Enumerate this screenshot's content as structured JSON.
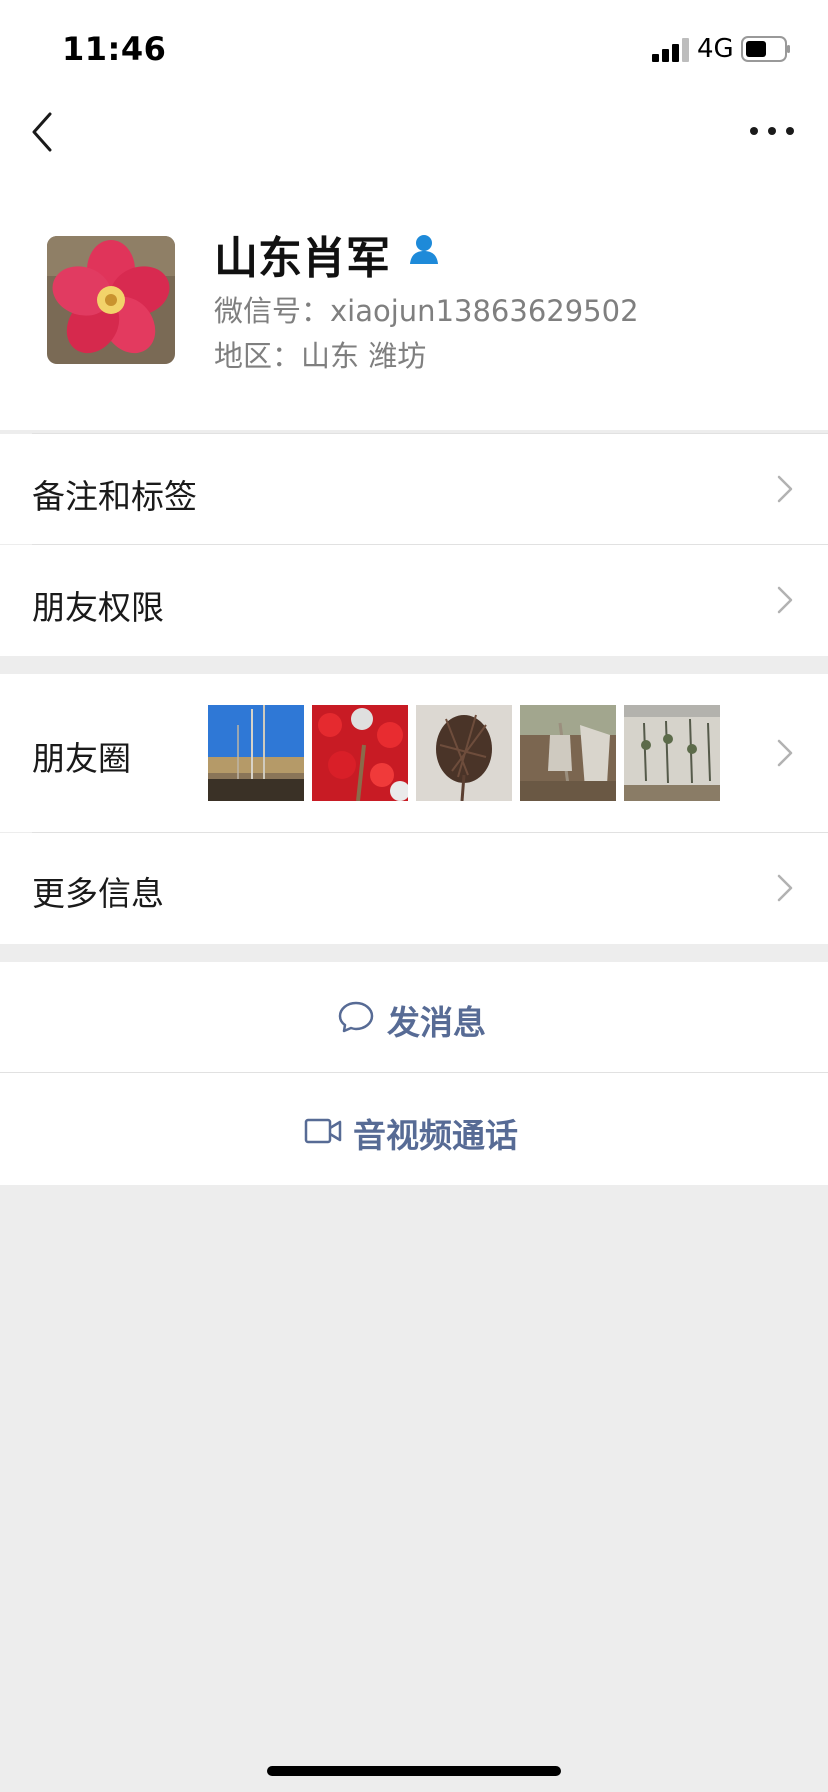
{
  "status_bar": {
    "time": "11:46",
    "network": "4G",
    "signal_icon": "signal-bars-icon",
    "battery_icon": "battery-icon"
  },
  "nav": {
    "back_icon": "chevron-left-icon",
    "more_icon": "more-dots-icon"
  },
  "profile": {
    "name": "山东肖军",
    "wechat_id_label": "微信号：",
    "wechat_id": "xiaojun13863629502",
    "region_label": "地区：",
    "region": "山东 潍坊",
    "contact_icon": "person-icon"
  },
  "menu": {
    "remarks_label": "备注和标签",
    "permissions_label": "朋友权限",
    "moments_label": "朋友圈",
    "more_info_label": "更多信息"
  },
  "actions": {
    "message_label": "发消息",
    "message_icon": "chat-bubble-icon",
    "call_label": "音视频通话",
    "call_icon": "video-camera-icon"
  },
  "colors": {
    "link": "#576b95",
    "background": "#ededed",
    "accent_blue": "#1e8ad9"
  }
}
